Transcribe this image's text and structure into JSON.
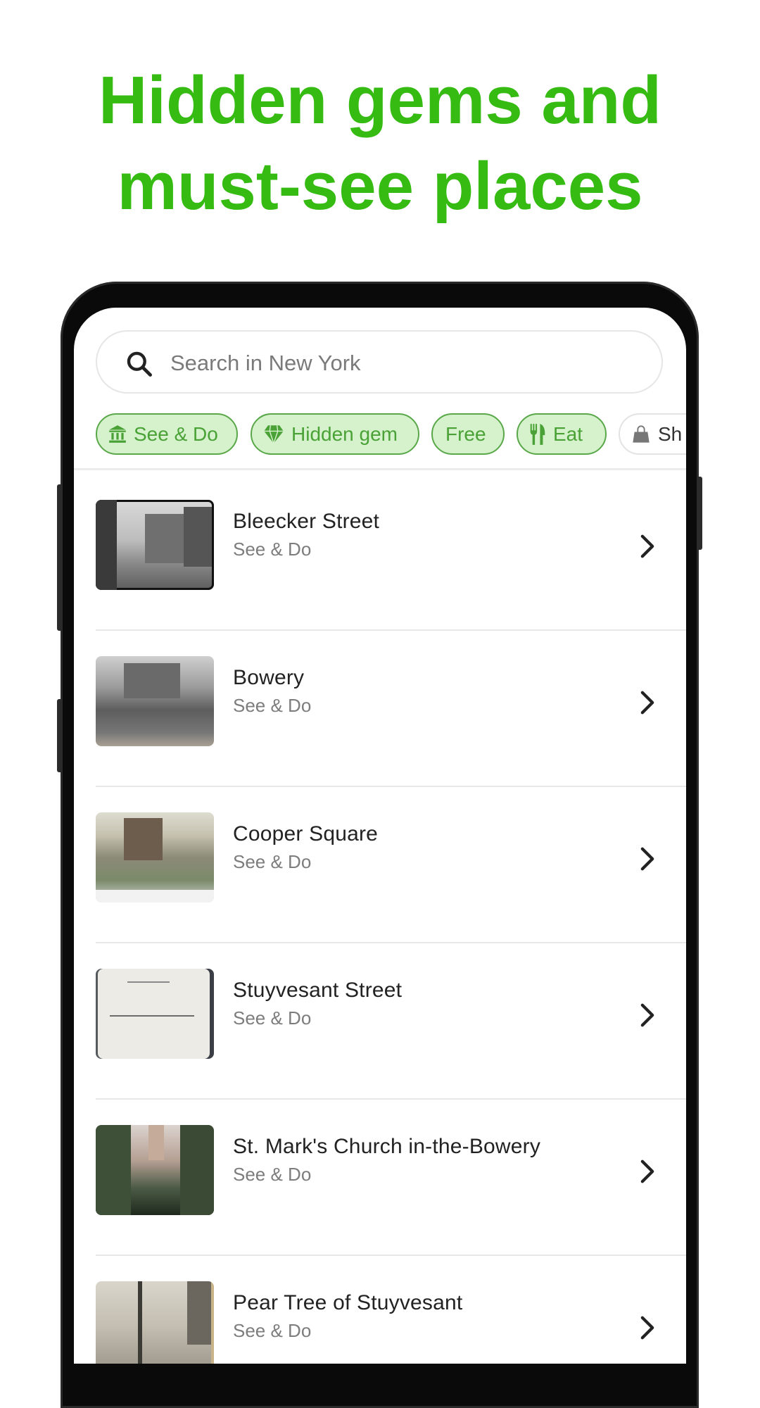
{
  "headline": {
    "line1": "Hidden gems and",
    "line2": "must-see places",
    "color": "#35bb12"
  },
  "search": {
    "icon": "search-icon",
    "placeholder": "Search in New York"
  },
  "chips": [
    {
      "label": "See & Do",
      "icon": "museum-icon",
      "selected": true
    },
    {
      "label": "Hidden gem",
      "icon": "diamond-icon",
      "selected": true
    },
    {
      "label": "Free",
      "icon": null,
      "selected": true
    },
    {
      "label": "Eat",
      "icon": "fork-knife-icon",
      "selected": true
    },
    {
      "label": "Sh",
      "icon": "shopping-bag-icon",
      "selected": false
    }
  ],
  "colors": {
    "chip_bg": "#d5f2cc",
    "chip_border": "#5aa84a",
    "chip_text": "#4aa237"
  },
  "places": [
    {
      "title": "Bleecker Street",
      "category": "See & Do",
      "thumb": "black-and-white street photo"
    },
    {
      "title": "Bowery",
      "category": "See & Do",
      "thumb": "engraving of house on rocks"
    },
    {
      "title": "Cooper Square",
      "category": "See & Do",
      "thumb": "color postcard of square"
    },
    {
      "title": "Stuyvesant Street",
      "category": "See & Do",
      "thumb": "handwritten map"
    },
    {
      "title": "St. Mark's Church in-the-Bowery",
      "category": "See & Do",
      "thumb": "church among trees"
    },
    {
      "title": "Pear Tree of Stuyvesant",
      "category": "See & Do",
      "thumb": "sketch of bare tree"
    }
  ]
}
